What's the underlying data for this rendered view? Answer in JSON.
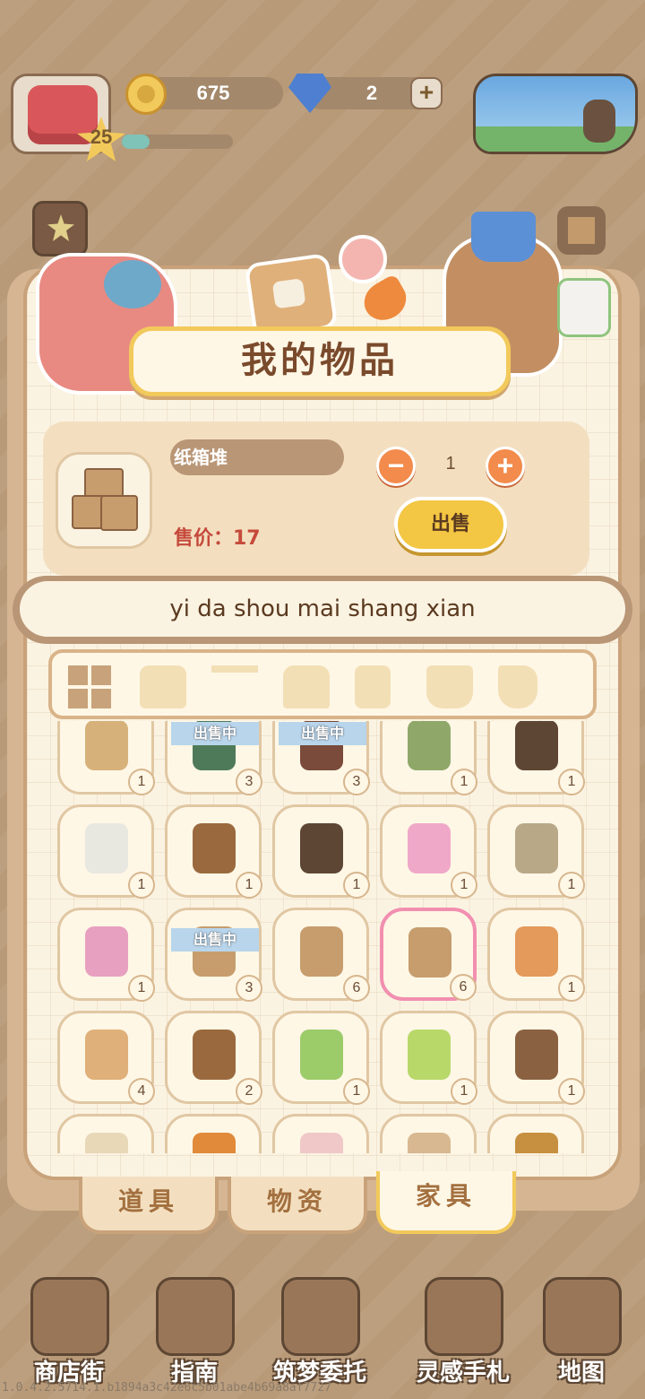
{
  "hud": {
    "coins": "675",
    "gems": "2",
    "level": "25",
    "xp_fraction": 0.25,
    "plus": "+"
  },
  "panel": {
    "title": "我的物品"
  },
  "detail": {
    "item_name": "纸箱堆",
    "price": "售价：17",
    "quantity": "1",
    "minus": "−",
    "plus": "+",
    "sell": "出售"
  },
  "toast": "yi da shou mai shang xian",
  "categories": [
    {
      "icon": "grid-icon",
      "active": true
    },
    {
      "icon": "sofa-icon"
    },
    {
      "icon": "table-icon"
    },
    {
      "icon": "bed-icon"
    },
    {
      "icon": "wardrobe-icon"
    },
    {
      "icon": "pot-icon"
    },
    {
      "icon": "toilet-icon"
    }
  ],
  "on_sale_label": "出售中",
  "items": [
    {
      "icon": "folding-screen-icon",
      "count": "1",
      "color": "#d6b27a"
    },
    {
      "icon": "potted-plant-icon",
      "count": "3",
      "color": "#4f7a5a",
      "onsale": true
    },
    {
      "icon": "mushroom-lamp-icon",
      "count": "3",
      "color": "#7a4a3a",
      "onsale": true
    },
    {
      "icon": "sapling-icon",
      "count": "1",
      "color": "#8fa86a"
    },
    {
      "icon": "plant-shelf-icon",
      "count": "1",
      "color": "#5d4633"
    },
    {
      "icon": "white-shelf-icon",
      "count": "1",
      "color": "#e8e8e0"
    },
    {
      "icon": "easel-icon",
      "count": "1",
      "color": "#9a6a3e"
    },
    {
      "icon": "drafting-table-icon",
      "count": "1",
      "color": "#5d4633"
    },
    {
      "icon": "princess-dress-icon",
      "count": "1",
      "color": "#f0a8c8"
    },
    {
      "icon": "coat-stand-icon",
      "count": "1",
      "color": "#b8a888"
    },
    {
      "icon": "bunny-cup-icon",
      "count": "1",
      "color": "#e8a0c0"
    },
    {
      "icon": "cardboard-box-icon",
      "count": "3",
      "color": "#c79d6d",
      "onsale": true
    },
    {
      "icon": "open-box-icon",
      "count": "6",
      "color": "#c79d6d"
    },
    {
      "icon": "box-pile-icon",
      "count": "6",
      "color": "#c79d6d",
      "selected": true
    },
    {
      "icon": "taped-box-icon",
      "count": "1",
      "color": "#e39a5a"
    },
    {
      "icon": "blue-tape-box-icon",
      "count": "4",
      "color": "#e0b07a"
    },
    {
      "icon": "cat-bed-icon",
      "count": "2",
      "color": "#9a6a3e"
    },
    {
      "icon": "green-hut-icon",
      "count": "1",
      "color": "#9ccb6a"
    },
    {
      "icon": "green-bed-icon",
      "count": "1",
      "color": "#b8d86a"
    },
    {
      "icon": "doghouse-icon",
      "count": "1",
      "color": "#8a6242"
    },
    {
      "icon": "small-cabinet-icon",
      "count": "",
      "color": "#e8d8b8"
    },
    {
      "icon": "orange-cat-icon",
      "count": "",
      "color": "#e08a3a"
    },
    {
      "icon": "pink-crate-icon",
      "count": "",
      "color": "#f0c8c8"
    },
    {
      "icon": "mushroom-stand-icon",
      "count": "",
      "color": "#d8b890"
    },
    {
      "icon": "teddy-bear-icon",
      "count": "",
      "color": "#c79040"
    }
  ],
  "tabs": [
    {
      "label": "道具"
    },
    {
      "label": "物资"
    },
    {
      "label": "家具",
      "active": true
    }
  ],
  "nav": [
    {
      "label": "商店街",
      "icon": "shop-icon"
    },
    {
      "label": "指南",
      "icon": "guide-book-icon"
    },
    {
      "label": "筑梦委托",
      "icon": "notebook-icon"
    },
    {
      "label": "灵感手札",
      "icon": "quill-book-icon"
    },
    {
      "label": "地图",
      "icon": "map-icon"
    }
  ],
  "version": "1.0.4.2.5714.1.b1894a3c42e6c5b01abe4b69a8af7727"
}
